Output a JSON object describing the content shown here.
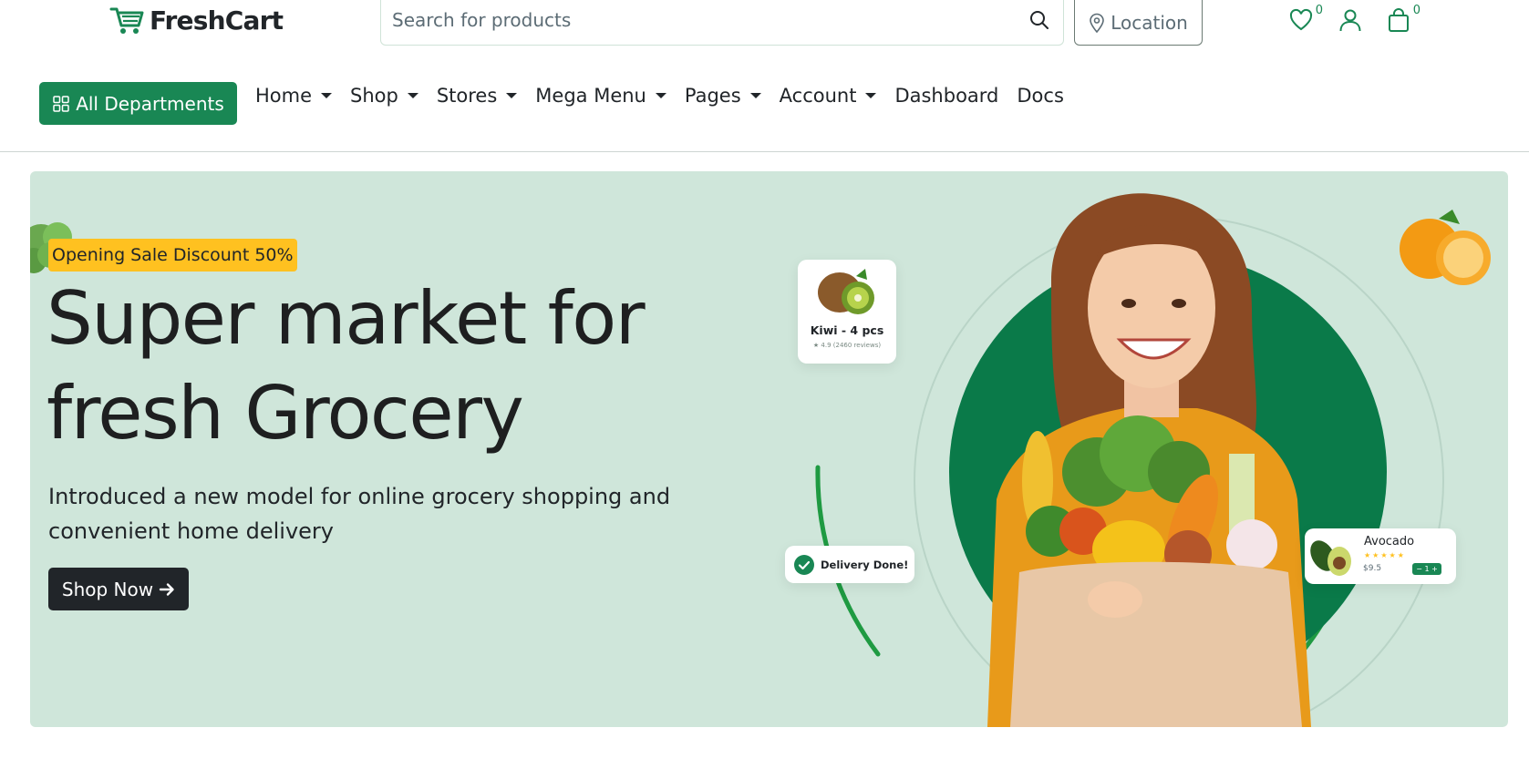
{
  "brand": {
    "name": "FreshCart"
  },
  "search": {
    "placeholder": "Search for products"
  },
  "location": {
    "label": "Location"
  },
  "header_icons": {
    "wishlist_count": "0",
    "cart_count": "0"
  },
  "nav": {
    "departments_label": "All Departments",
    "items": [
      {
        "label": "Home",
        "dropdown": true
      },
      {
        "label": "Shop",
        "dropdown": true
      },
      {
        "label": "Stores",
        "dropdown": true
      },
      {
        "label": "Mega Menu",
        "dropdown": true
      },
      {
        "label": "Pages",
        "dropdown": true
      },
      {
        "label": "Account",
        "dropdown": true
      },
      {
        "label": "Dashboard",
        "dropdown": false
      },
      {
        "label": "Docs",
        "dropdown": false
      }
    ]
  },
  "hero": {
    "badge": "Opening Sale Discount 50%",
    "title_line1": "Super market for",
    "title_line2": "fresh Grocery",
    "subtitle": "Introduced a new model for online grocery shopping and convenient home delivery",
    "cta_label": "Shop Now",
    "cards": {
      "kiwi": {
        "name": "Kiwi - 4 pcs",
        "rating": "★ 4.9  (2460 reviews)"
      },
      "delivery": {
        "label": "Delivery Done!"
      },
      "avocado": {
        "name": "Avocado",
        "stars": "★★★★★",
        "price": "$9.5",
        "qty": "− 1 +"
      }
    }
  },
  "colors": {
    "brand_green": "#198754",
    "hero_bg": "#cfe6da",
    "badge_yellow": "#ffc120",
    "dark_button": "#212529"
  },
  "icons": [
    "cart-logo-icon",
    "search-icon",
    "location-pin-icon",
    "heart-icon",
    "user-icon",
    "shopping-bag-icon",
    "grid-icon",
    "arrow-right-icon",
    "check-circle-icon"
  ]
}
